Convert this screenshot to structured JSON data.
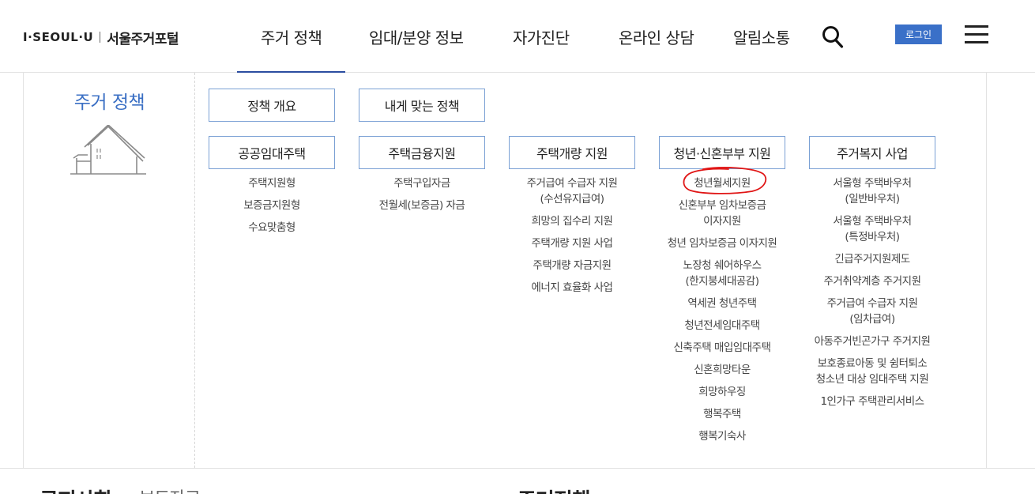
{
  "header": {
    "logo_brand": "I·SEOUL·U",
    "logo_name": "서울주거포털",
    "nav": [
      "주거 정책",
      "임대/분양 정보",
      "자가진단",
      "온라인 상담",
      "알림소통"
    ],
    "login_label": "로그인",
    "icons": {
      "search": "search-icon",
      "menu": "hamburger-menu-icon"
    },
    "accent_color": "#2b4da0",
    "login_color": "#3a70c8"
  },
  "panel": {
    "title": "주거 정책",
    "top_buttons": [
      "정책 개요",
      "내게 맞는 정책"
    ],
    "categories": [
      {
        "label": "공공임대주택",
        "items": [
          "주택지원형",
          "보증금지원형",
          "수요맞춤형"
        ]
      },
      {
        "label": "주택금융지원",
        "items": [
          "주택구입자금",
          "전월세(보증금) 자금"
        ]
      },
      {
        "label": "주택개량 지원",
        "items": [
          "주거급여 수급자 지원\n(수선유지급여)",
          "희망의 집수리 지원",
          "주택개량 지원 사업",
          "주택개량 자금지원",
          "에너지 효율화 사업"
        ]
      },
      {
        "label": "청년·신혼부부 지원",
        "items": [
          "청년월세지원",
          "신혼부부 임차보증금\n이자지원",
          "청년 임차보증금 이자지원",
          "노장청 쉐어하우스\n(한지붕세대공감)",
          "역세권 청년주택",
          "청년전세임대주택",
          "신축주택 매입임대주택",
          "신혼희망타운",
          "희망하우징",
          "행복주택",
          "행복기숙사"
        ]
      },
      {
        "label": "주거복지 사업",
        "items": [
          "서울형 주택바우처\n(일반바우처)",
          "서울형 주택바우처\n(특정바우처)",
          "긴급주거지원제도",
          "주거취약계층 주거지원",
          "주거급여 수급자 지원\n(임차급여)",
          "아동주거빈곤가구 주거지원",
          "보호종료아동 및 쉼터퇴소\n청소년 대상 임대주택 지원",
          "1인가구 주택관리서비스"
        ]
      }
    ]
  },
  "bottom": {
    "texts": [
      "공지사항",
      "보도자료",
      "주거정책"
    ]
  }
}
